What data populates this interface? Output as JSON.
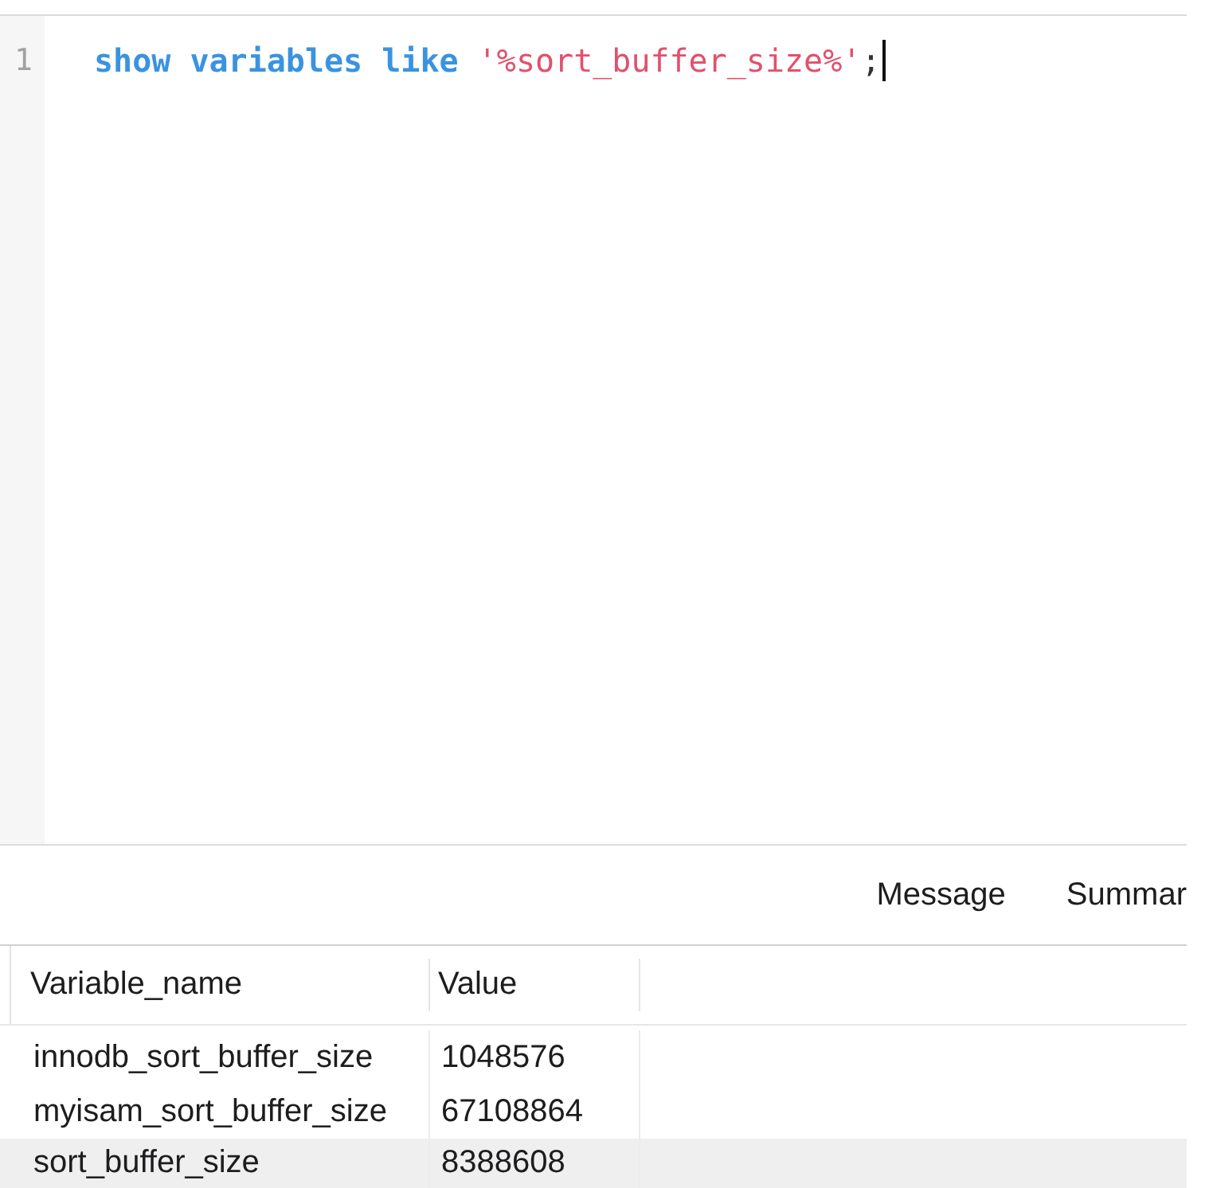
{
  "editor": {
    "lines": [
      {
        "number": "1",
        "tokens": [
          {
            "kind": "keyword",
            "text": "show"
          },
          {
            "kind": "keyword",
            "text": "variables"
          },
          {
            "kind": "keyword",
            "text": "like"
          },
          {
            "kind": "string",
            "text": "'%sort_buffer_size%'"
          },
          {
            "kind": "punct",
            "text": ";"
          }
        ],
        "caret": true
      }
    ]
  },
  "result_tabs": [
    {
      "label": "Message"
    },
    {
      "label": "Summar"
    }
  ],
  "table": {
    "columns": [
      "Variable_name",
      "Value"
    ],
    "rows": [
      {
        "cells": [
          "innodb_sort_buffer_size",
          "1048576"
        ],
        "selected": false
      },
      {
        "cells": [
          "myisam_sort_buffer_size",
          "67108864"
        ],
        "selected": false
      },
      {
        "cells": [
          "sort_buffer_size",
          "8388608"
        ],
        "selected": true
      }
    ]
  }
}
